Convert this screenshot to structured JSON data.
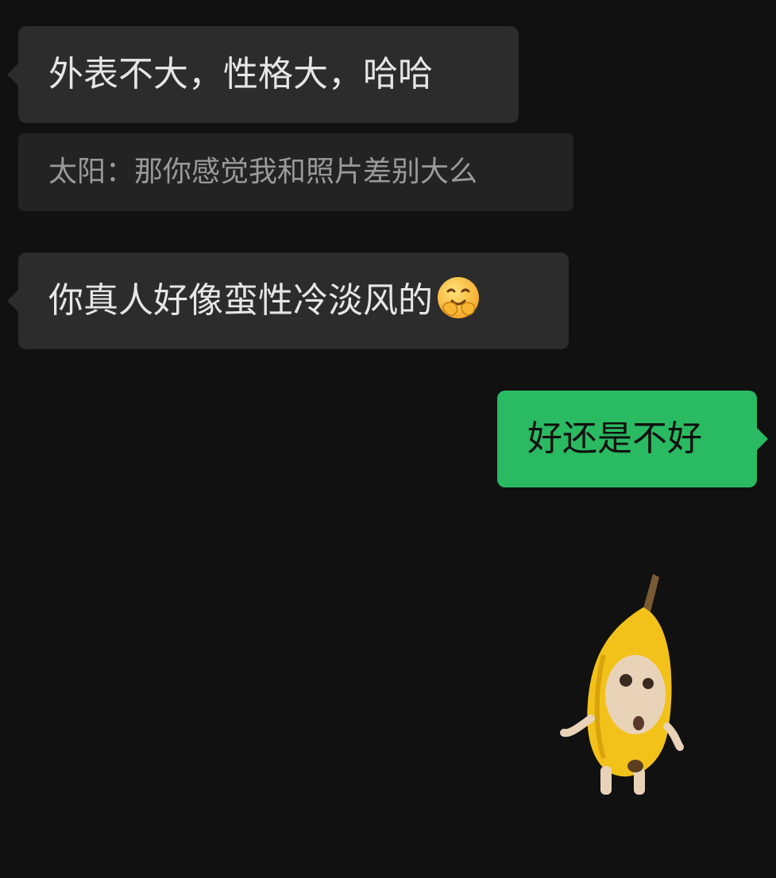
{
  "conversation": {
    "messages": [
      {
        "sender": "other",
        "text": "外表不大，性格大，哈哈"
      },
      {
        "type": "quote",
        "text": "太阳：那你感觉我和照片差别大么"
      },
      {
        "sender": "other",
        "text": "你真人好像蛮性冷淡风的",
        "emoji": "hugging-face-emoji"
      },
      {
        "sender": "me",
        "text": "好还是不好"
      },
      {
        "sender": "me",
        "type": "sticker",
        "sticker": "banana-cat-sticker"
      }
    ]
  },
  "colors": {
    "background": "#111111",
    "incoming_bubble": "#2c2c2c",
    "quote_bubble": "#232323",
    "outgoing_bubble": "#2aba62",
    "incoming_text": "#e6e6e6",
    "quote_text": "#9a9a9a",
    "outgoing_text": "#101010"
  }
}
